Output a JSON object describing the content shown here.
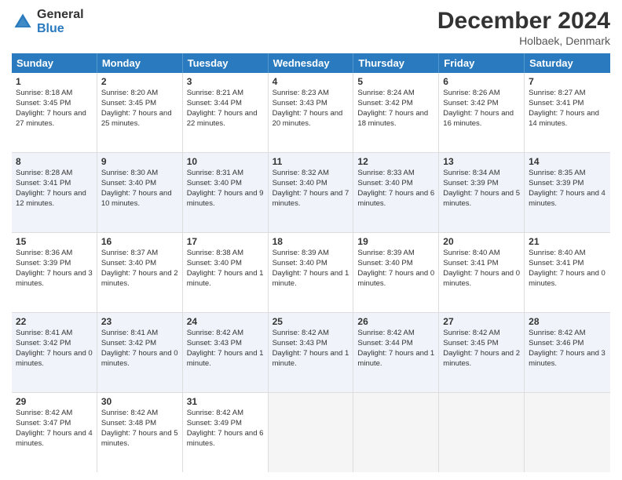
{
  "logo": {
    "general": "General",
    "blue": "Blue"
  },
  "title": "December 2024",
  "location": "Holbaek, Denmark",
  "days": [
    "Sunday",
    "Monday",
    "Tuesday",
    "Wednesday",
    "Thursday",
    "Friday",
    "Saturday"
  ],
  "weeks": [
    [
      {
        "day": "1",
        "sunrise": "Sunrise: 8:18 AM",
        "sunset": "Sunset: 3:45 PM",
        "daylight": "Daylight: 7 hours and 27 minutes."
      },
      {
        "day": "2",
        "sunrise": "Sunrise: 8:20 AM",
        "sunset": "Sunset: 3:45 PM",
        "daylight": "Daylight: 7 hours and 25 minutes."
      },
      {
        "day": "3",
        "sunrise": "Sunrise: 8:21 AM",
        "sunset": "Sunset: 3:44 PM",
        "daylight": "Daylight: 7 hours and 22 minutes."
      },
      {
        "day": "4",
        "sunrise": "Sunrise: 8:23 AM",
        "sunset": "Sunset: 3:43 PM",
        "daylight": "Daylight: 7 hours and 20 minutes."
      },
      {
        "day": "5",
        "sunrise": "Sunrise: 8:24 AM",
        "sunset": "Sunset: 3:42 PM",
        "daylight": "Daylight: 7 hours and 18 minutes."
      },
      {
        "day": "6",
        "sunrise": "Sunrise: 8:26 AM",
        "sunset": "Sunset: 3:42 PM",
        "daylight": "Daylight: 7 hours and 16 minutes."
      },
      {
        "day": "7",
        "sunrise": "Sunrise: 8:27 AM",
        "sunset": "Sunset: 3:41 PM",
        "daylight": "Daylight: 7 hours and 14 minutes."
      }
    ],
    [
      {
        "day": "8",
        "sunrise": "Sunrise: 8:28 AM",
        "sunset": "Sunset: 3:41 PM",
        "daylight": "Daylight: 7 hours and 12 minutes."
      },
      {
        "day": "9",
        "sunrise": "Sunrise: 8:30 AM",
        "sunset": "Sunset: 3:40 PM",
        "daylight": "Daylight: 7 hours and 10 minutes."
      },
      {
        "day": "10",
        "sunrise": "Sunrise: 8:31 AM",
        "sunset": "Sunset: 3:40 PM",
        "daylight": "Daylight: 7 hours and 9 minutes."
      },
      {
        "day": "11",
        "sunrise": "Sunrise: 8:32 AM",
        "sunset": "Sunset: 3:40 PM",
        "daylight": "Daylight: 7 hours and 7 minutes."
      },
      {
        "day": "12",
        "sunrise": "Sunrise: 8:33 AM",
        "sunset": "Sunset: 3:40 PM",
        "daylight": "Daylight: 7 hours and 6 minutes."
      },
      {
        "day": "13",
        "sunrise": "Sunrise: 8:34 AM",
        "sunset": "Sunset: 3:39 PM",
        "daylight": "Daylight: 7 hours and 5 minutes."
      },
      {
        "day": "14",
        "sunrise": "Sunrise: 8:35 AM",
        "sunset": "Sunset: 3:39 PM",
        "daylight": "Daylight: 7 hours and 4 minutes."
      }
    ],
    [
      {
        "day": "15",
        "sunrise": "Sunrise: 8:36 AM",
        "sunset": "Sunset: 3:39 PM",
        "daylight": "Daylight: 7 hours and 3 minutes."
      },
      {
        "day": "16",
        "sunrise": "Sunrise: 8:37 AM",
        "sunset": "Sunset: 3:40 PM",
        "daylight": "Daylight: 7 hours and 2 minutes."
      },
      {
        "day": "17",
        "sunrise": "Sunrise: 8:38 AM",
        "sunset": "Sunset: 3:40 PM",
        "daylight": "Daylight: 7 hours and 1 minute."
      },
      {
        "day": "18",
        "sunrise": "Sunrise: 8:39 AM",
        "sunset": "Sunset: 3:40 PM",
        "daylight": "Daylight: 7 hours and 1 minute."
      },
      {
        "day": "19",
        "sunrise": "Sunrise: 8:39 AM",
        "sunset": "Sunset: 3:40 PM",
        "daylight": "Daylight: 7 hours and 0 minutes."
      },
      {
        "day": "20",
        "sunrise": "Sunrise: 8:40 AM",
        "sunset": "Sunset: 3:41 PM",
        "daylight": "Daylight: 7 hours and 0 minutes."
      },
      {
        "day": "21",
        "sunrise": "Sunrise: 8:40 AM",
        "sunset": "Sunset: 3:41 PM",
        "daylight": "Daylight: 7 hours and 0 minutes."
      }
    ],
    [
      {
        "day": "22",
        "sunrise": "Sunrise: 8:41 AM",
        "sunset": "Sunset: 3:42 PM",
        "daylight": "Daylight: 7 hours and 0 minutes."
      },
      {
        "day": "23",
        "sunrise": "Sunrise: 8:41 AM",
        "sunset": "Sunset: 3:42 PM",
        "daylight": "Daylight: 7 hours and 0 minutes."
      },
      {
        "day": "24",
        "sunrise": "Sunrise: 8:42 AM",
        "sunset": "Sunset: 3:43 PM",
        "daylight": "Daylight: 7 hours and 1 minute."
      },
      {
        "day": "25",
        "sunrise": "Sunrise: 8:42 AM",
        "sunset": "Sunset: 3:43 PM",
        "daylight": "Daylight: 7 hours and 1 minute."
      },
      {
        "day": "26",
        "sunrise": "Sunrise: 8:42 AM",
        "sunset": "Sunset: 3:44 PM",
        "daylight": "Daylight: 7 hours and 1 minute."
      },
      {
        "day": "27",
        "sunrise": "Sunrise: 8:42 AM",
        "sunset": "Sunset: 3:45 PM",
        "daylight": "Daylight: 7 hours and 2 minutes."
      },
      {
        "day": "28",
        "sunrise": "Sunrise: 8:42 AM",
        "sunset": "Sunset: 3:46 PM",
        "daylight": "Daylight: 7 hours and 3 minutes."
      }
    ],
    [
      {
        "day": "29",
        "sunrise": "Sunrise: 8:42 AM",
        "sunset": "Sunset: 3:47 PM",
        "daylight": "Daylight: 7 hours and 4 minutes."
      },
      {
        "day": "30",
        "sunrise": "Sunrise: 8:42 AM",
        "sunset": "Sunset: 3:48 PM",
        "daylight": "Daylight: 7 hours and 5 minutes."
      },
      {
        "day": "31",
        "sunrise": "Sunrise: 8:42 AM",
        "sunset": "Sunset: 3:49 PM",
        "daylight": "Daylight: 7 hours and 6 minutes."
      },
      null,
      null,
      null,
      null
    ]
  ]
}
